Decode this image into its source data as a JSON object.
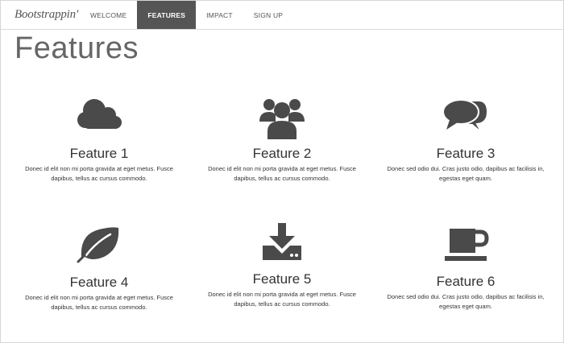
{
  "brand": "Bootstrappin'",
  "nav": [
    {
      "label": "WELCOME",
      "active": false
    },
    {
      "label": "FEATURES",
      "active": true
    },
    {
      "label": "IMPACT",
      "active": false
    },
    {
      "label": "SIGN UP",
      "active": false
    }
  ],
  "page_title": "Features",
  "features": [
    {
      "icon": "cloud-icon",
      "title": "Feature 1",
      "text": "Donec id elit non mi porta gravida at eget metus. Fusce dapibus, tellus ac cursus commodo."
    },
    {
      "icon": "users-icon",
      "title": "Feature 2",
      "text": "Donec id elit non mi porta gravida at eget metus. Fusce dapibus, tellus ac cursus commodo."
    },
    {
      "icon": "comments-icon",
      "title": "Feature 3",
      "text": "Donec sed odio dui. Cras justo odio, dapibus ac facilisis in, egestas eget quam."
    },
    {
      "icon": "leaf-icon",
      "title": "Feature 4",
      "text": "Donec id elit non mi porta gravida at eget metus. Fusce dapibus, tellus ac cursus commodo."
    },
    {
      "icon": "download-icon",
      "title": "Feature 5",
      "text": "Donec id elit non mi porta gravida at eget metus. Fusce dapibus, tellus ac cursus commodo."
    },
    {
      "icon": "coffee-icon",
      "title": "Feature 6",
      "text": "Donec sed odio dui. Cras justo odio, dapibus ac facilisis in, egestas eget quam."
    }
  ],
  "colors": {
    "icon": "#4a4a4a",
    "active_nav_bg": "#555555",
    "title": "#666666"
  }
}
